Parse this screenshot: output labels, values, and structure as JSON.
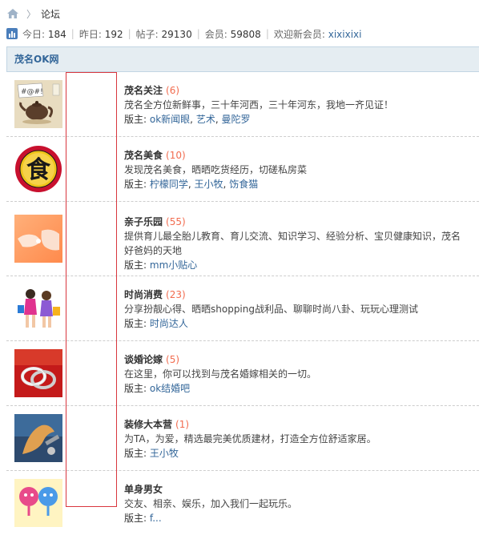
{
  "breadcrumb": {
    "current": "论坛",
    "separator": "〉"
  },
  "stats": {
    "today_label": "今日:",
    "today_value": "184",
    "yesterday_label": "昨日:",
    "yesterday_value": "192",
    "posts_label": "帖子:",
    "posts_value": "29130",
    "members_label": "会员:",
    "members_value": "59808",
    "welcome_label": "欢迎新会员:",
    "newest_member": "xixixixi"
  },
  "panel": {
    "title": "茂名OK网"
  },
  "forums": [
    {
      "name": "茂名关注",
      "count": "(6)",
      "desc": "茂名全方位新鲜事，三十年河西，三十年河东，我地一齐见证！",
      "mods_label": "版主:",
      "mods": [
        "ok新闻眼",
        "艺术",
        "曼陀罗"
      ]
    },
    {
      "name": "茂名美食",
      "count": "(10)",
      "desc": "发现茂名美食，晒晒吃货经历，切磋私房菜",
      "mods_label": "版主:",
      "mods": [
        "柠檬同学",
        "王小牧",
        "饬食猫"
      ]
    },
    {
      "name": "亲子乐园",
      "count": "(55)",
      "desc": "提供育儿最全胎儿教育、育儿交流、知识学习、经验分析、宝贝健康知识，茂名好爸妈的天地",
      "mods_label": "版主:",
      "mods": [
        "mm小贴心"
      ]
    },
    {
      "name": "时尚消费",
      "count": "(23)",
      "desc": "分享扮靓心得、晒晒shopping战利品、聊聊时尚八卦、玩玩心理测试",
      "mods_label": "版主:",
      "mods": [
        "时尚达人"
      ]
    },
    {
      "name": "谈婚论嫁",
      "count": "(5)",
      "desc": "在这里，你可以找到与茂名婚嫁相关的一切。",
      "mods_label": "版主:",
      "mods": [
        "ok结婚吧"
      ]
    },
    {
      "name": "装修大本营",
      "count": "(1)",
      "desc": "为TA，为爱，精选最完美优质建材，打造全方位舒适家居。",
      "mods_label": "版主:",
      "mods": [
        "王小牧"
      ]
    },
    {
      "name": "单身男女",
      "count": "",
      "desc": "交友、相亲、娱乐，加入我们一起玩乐。",
      "mods_label": "版主:",
      "mods": [
        "f..."
      ]
    }
  ],
  "icon_names": [
    "teapot-icon",
    "food-icon",
    "hands-icon",
    "shopping-girls-icon",
    "rings-icon",
    "tools-icon",
    "couple-icon"
  ],
  "colors": {
    "accent": "#336699",
    "count": "#f26c4f",
    "header_bg": "#e5edf2",
    "highlight": "#d9363e"
  }
}
